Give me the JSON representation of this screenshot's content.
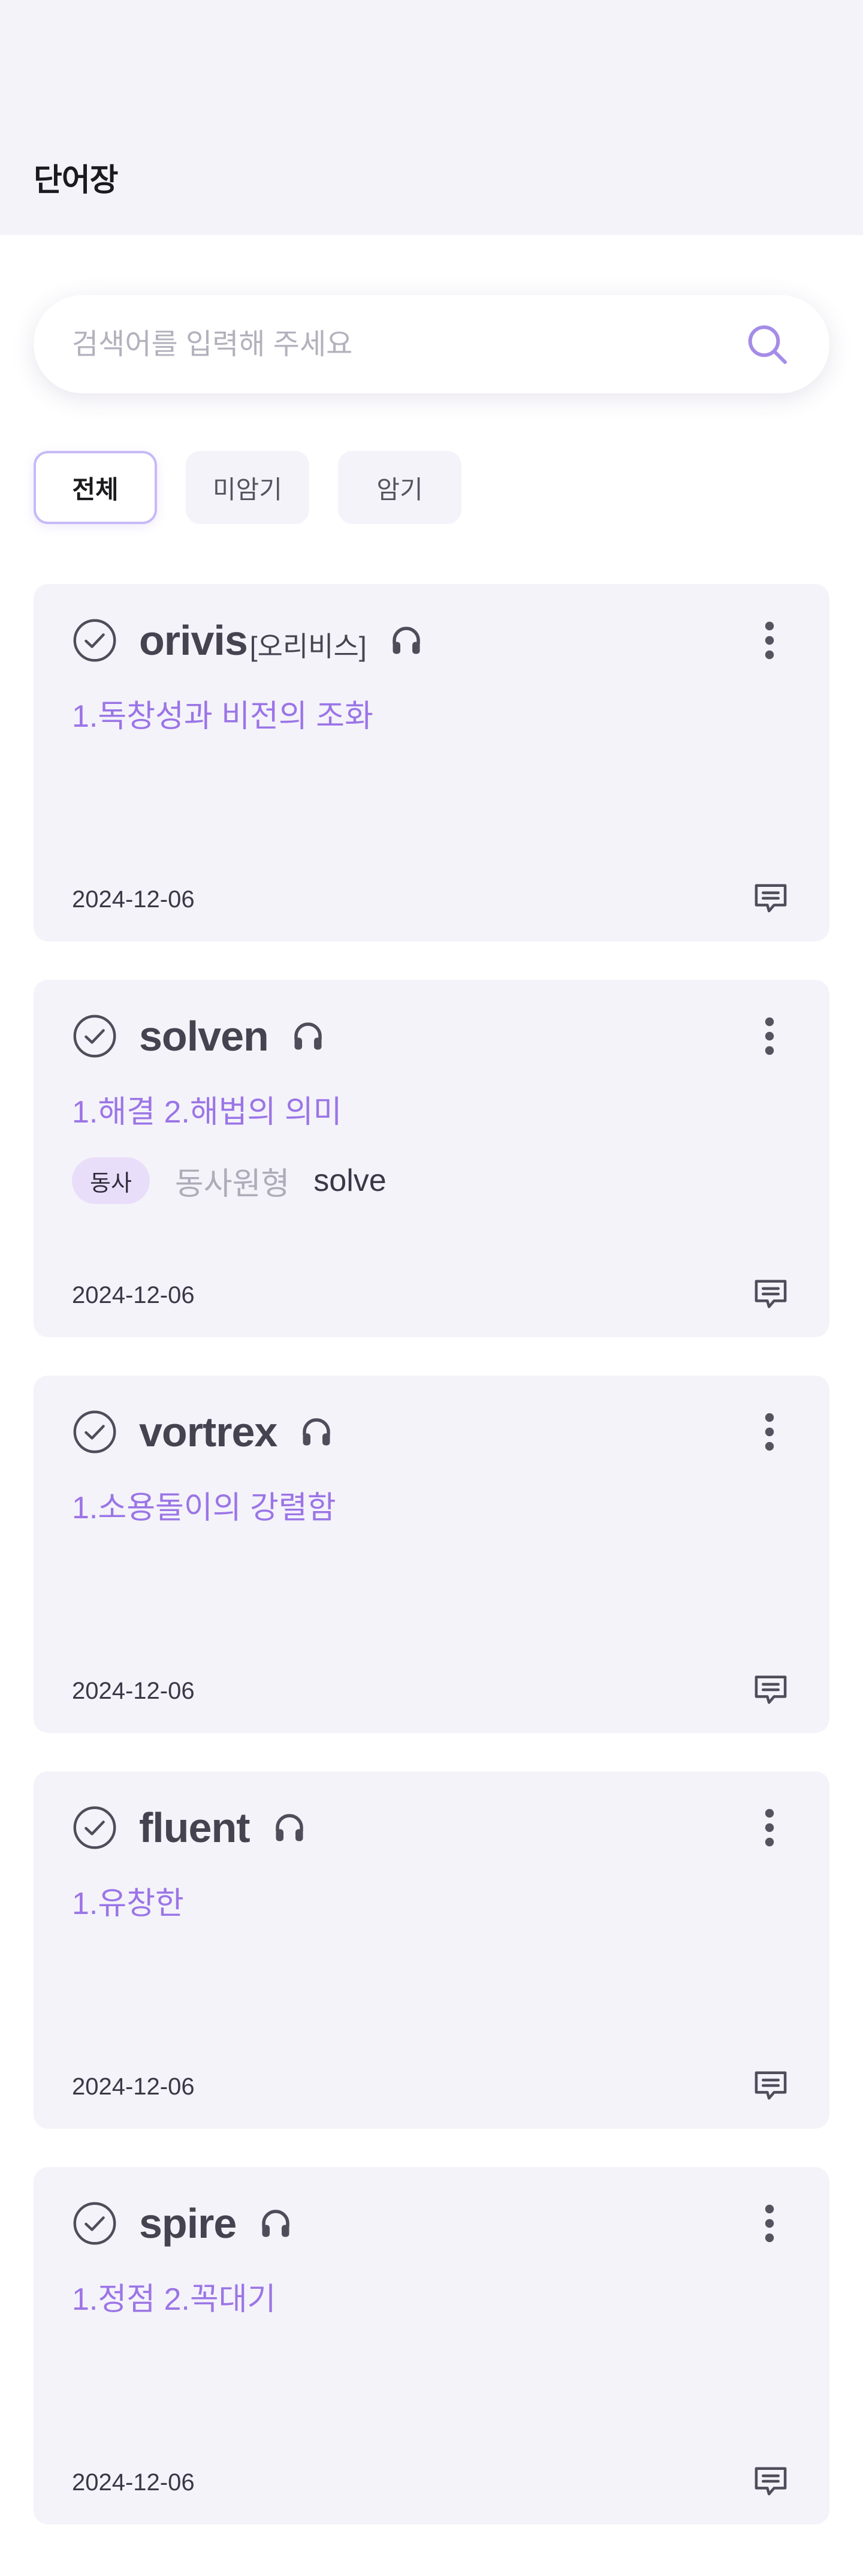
{
  "header": {
    "title": "단어장"
  },
  "search": {
    "placeholder": "검색어를 입력해 주세요",
    "value": ""
  },
  "filters": [
    {
      "label": "전체",
      "active": true
    },
    {
      "label": "미암기",
      "active": false
    },
    {
      "label": "암기",
      "active": false
    }
  ],
  "cards": [
    {
      "word": "orivis",
      "pronunciation": "[오리비스]",
      "meaning": "1.독창성과 비전의 조화",
      "tag": null,
      "date": "2024-12-06"
    },
    {
      "word": "solven",
      "pronunciation": "",
      "meaning": "1.해결 2.해법의 의미",
      "tag": {
        "badge": "동사",
        "key": "동사원형",
        "value": "solve"
      },
      "date": "2024-12-06"
    },
    {
      "word": "vortrex",
      "pronunciation": "",
      "meaning": "1.소용돌이의 강렬함",
      "tag": null,
      "date": "2024-12-06"
    },
    {
      "word": "fluent",
      "pronunciation": "",
      "meaning": "1.유창한",
      "tag": null,
      "date": "2024-12-06"
    },
    {
      "word": "spire",
      "pronunciation": "",
      "meaning": "1.정점 2.꼭대기",
      "tag": null,
      "date": "2024-12-06"
    }
  ],
  "colors": {
    "accent": "#9b75e6",
    "card_background": "#f4f3fa",
    "header_background": "#f4f3f9",
    "tag_badge_background": "#e9def9"
  },
  "icons": {
    "search": "search-icon",
    "check": "check-circle-icon",
    "audio": "headphones-icon",
    "more": "more-vertical-icon",
    "memo": "comment-icon"
  }
}
